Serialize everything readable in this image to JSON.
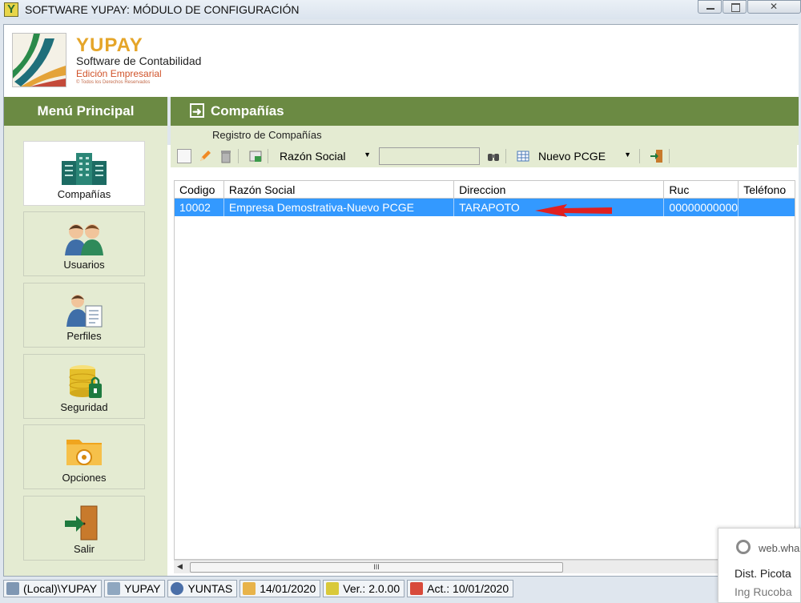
{
  "window": {
    "title": "SOFTWARE YUPAY: MÓDULO DE CONFIGURACIÓN"
  },
  "logo": {
    "brand": "YUPAY",
    "tagline": "Software de Contabilidad",
    "edition": "Edición Empresarial",
    "rights": "© Todos los Derechos Reservados"
  },
  "menu": {
    "header": "Menú Principal",
    "items": [
      {
        "label": "Compañías",
        "icon": "buildings-icon",
        "active": true
      },
      {
        "label": "Usuarios",
        "icon": "users-icon"
      },
      {
        "label": "Perfiles",
        "icon": "profile-icon"
      },
      {
        "label": "Seguridad",
        "icon": "database-lock-icon"
      },
      {
        "label": "Opciones",
        "icon": "options-folder-icon"
      },
      {
        "label": "Salir",
        "icon": "exit-door-icon"
      }
    ]
  },
  "content": {
    "header": "Compañías",
    "subtitle": "Registro de Compañías",
    "toolbar": {
      "search_field": "Razón Social",
      "search_value": "",
      "plan": "Nuevo PCGE"
    },
    "grid": {
      "columns": [
        "Codigo",
        "Razón Social",
        "Direccion",
        "Ruc",
        "Teléfono"
      ],
      "rows": [
        [
          "10002",
          "Empresa Demostrativa-Nuevo PCGE",
          "TARAPOTO",
          "00000000000",
          ""
        ]
      ]
    },
    "scroll_label": "III"
  },
  "statusbar": {
    "items": [
      "(Local)\\YUPAY",
      "YUPAY",
      "YUNTAS",
      "14/01/2020",
      "Ver.: 2.0.00",
      "Act.: 10/01/2020"
    ]
  },
  "notification": {
    "source": "web.wha",
    "line1": "Dist. Picota",
    "line2": "Ing Rucoba"
  },
  "colors": {
    "menu_green": "#6b8a43",
    "panel_bg": "#e4ebd2",
    "selection": "#3399ff",
    "brand_orange": "#e5a529"
  }
}
